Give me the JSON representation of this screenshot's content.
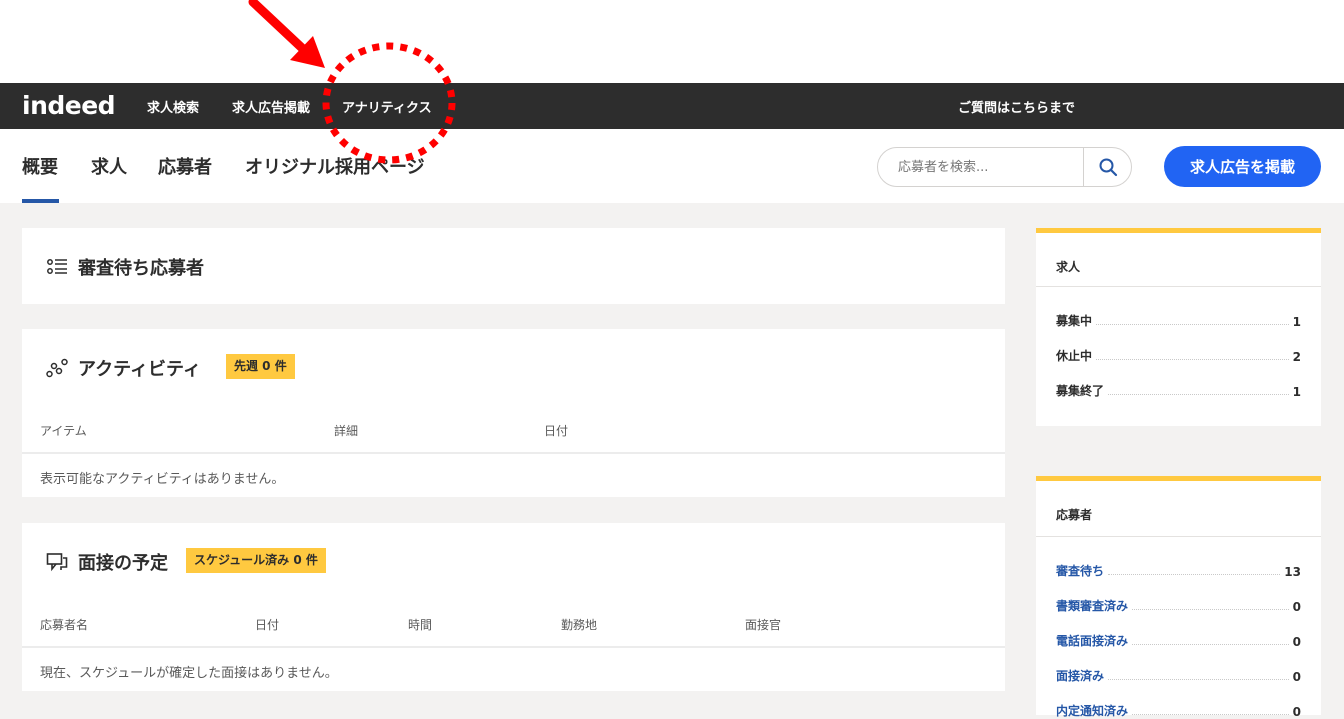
{
  "nav": {
    "logo": "indeed",
    "links": [
      "求人検索",
      "求人広告掲載",
      "アナリティクス"
    ],
    "help": "ご質問はこちらまで"
  },
  "subnav": {
    "tabs": [
      "概要",
      "求人",
      "応募者",
      "オリジナル採用ページ"
    ],
    "search_placeholder": "応募者を検索...",
    "post_button": "求人広告を掲載"
  },
  "pending": {
    "title": "審査待ち応募者"
  },
  "activity": {
    "title": "アクティビティ",
    "badge": "先週 0 件",
    "columns": [
      "アイテム",
      "詳細",
      "日付"
    ],
    "empty": "表示可能なアクティビティはありません。"
  },
  "interview": {
    "title": "面接の予定",
    "badge": "スケジュール済み 0 件",
    "columns": [
      "応募者名",
      "日付",
      "時間",
      "勤務地",
      "面接官"
    ],
    "empty": "現在、スケジュールが確定した面接はありません。"
  },
  "jobs_summary": {
    "title": "求人",
    "rows": [
      {
        "label": "募集中",
        "value": "1"
      },
      {
        "label": "休止中",
        "value": "2"
      },
      {
        "label": "募集終了",
        "value": "1"
      }
    ]
  },
  "applicants_summary": {
    "title": "応募者",
    "rows": [
      {
        "label": "審査待ち",
        "value": "13"
      },
      {
        "label": "書類審査済み",
        "value": "0"
      },
      {
        "label": "電話面接済み",
        "value": "0"
      },
      {
        "label": "面接済み",
        "value": "0"
      },
      {
        "label": "内定通知済み",
        "value": "0"
      }
    ]
  },
  "colors": {
    "navbar": "#2d2d2d",
    "accent_blue": "#2164f3",
    "badge_yellow": "#ffc940",
    "annotation_red": "#ff0000"
  },
  "icons": [
    "search-icon",
    "list-icon",
    "activity-icon",
    "chat-icon",
    "arrow-annotation",
    "dotted-circle-annotation"
  ]
}
